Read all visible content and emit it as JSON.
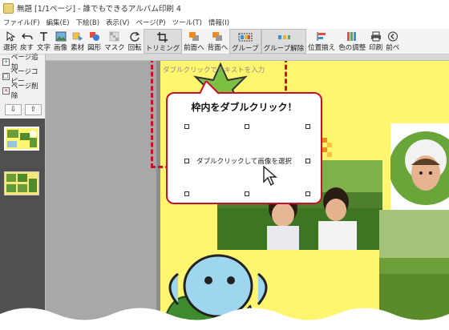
{
  "window": {
    "title": "無題 [1/1ページ] - 誰でもできるアルバム印刷 4"
  },
  "menu": [
    "ファイル(F)",
    "編集(E)",
    "下絵(B)",
    "表示(V)",
    "ページ(P)",
    "ツール(T)",
    "情報(I)"
  ],
  "toolbar": {
    "select": "選択",
    "undo": "戻す",
    "text": "文字",
    "image": "画像",
    "material": "素材",
    "shape": "図形",
    "mask": "マスク",
    "rotate": "回転",
    "trim": "トリミング",
    "front": "前面へ",
    "back": "背面へ",
    "group": "グループ",
    "ungroup": "グループ解除",
    "align": "位置揃え",
    "color": "色の調整",
    "print": "印刷",
    "prev": "前ペ"
  },
  "sidebar": {
    "add_page": "ページ追加",
    "copy_page": "ページコピー",
    "delete_page": "ページ削除",
    "down_arrow": "⇩",
    "up_arrow": "⇧"
  },
  "canvas": {
    "text_hint": "ダブルクリックでテキストを入力",
    "callout_title": "枠内をダブルクリック！",
    "callout_sub": "ダブルクリックして画像を選択"
  },
  "colors": {
    "accent": "#c8102e",
    "page_bg": "#fff56f",
    "thumb_bg": "#505050"
  },
  "icons": [
    "arrow-cursor-icon",
    "undo-icon",
    "text-icon",
    "image-icon",
    "material-icon",
    "shape-icon",
    "mask-icon",
    "rotate-icon",
    "trim-icon",
    "front-icon",
    "back-icon",
    "group-icon",
    "ungroup-icon",
    "align-icon",
    "color-adjust-icon",
    "print-icon",
    "prev-page-icon"
  ]
}
